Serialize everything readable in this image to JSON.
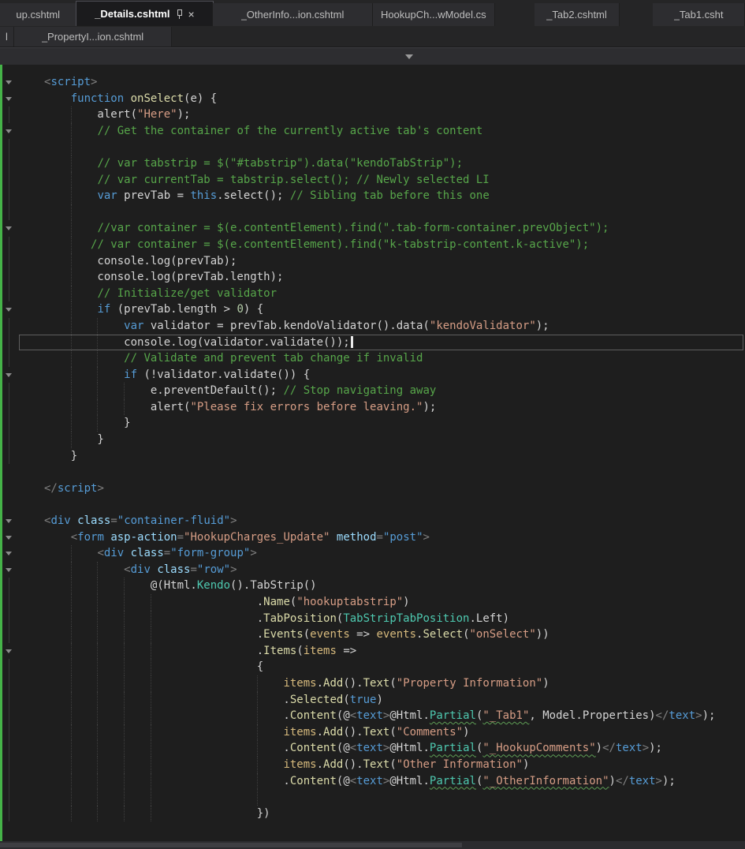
{
  "tabs": {
    "row1": [
      {
        "label": "up.cshtml"
      },
      {
        "label": "_Details.cshtml"
      },
      {
        "label": "_OtherInfo...ion.cshtml"
      },
      {
        "label": "HookupCh...wModel.cs"
      },
      {
        "label": "_Tab2.cshtml"
      },
      {
        "label": "_Tab1.csht"
      }
    ],
    "row2": [
      {
        "label": "l"
      },
      {
        "label": "_PropertyI...ion.cshtml"
      }
    ]
  },
  "icons": {
    "close": "×"
  },
  "palette": {
    "background": "#1e1e1e",
    "tab_strip": "#252526",
    "tab": "#2d2d30",
    "active_tab_text": "#ffffff",
    "keyword": "#569cd6",
    "string": "#d69d85",
    "comment": "#57a64a",
    "method": "#dcdcaa",
    "type": "#4ec9b0",
    "parameter": "#d7ba7d",
    "number": "#b5cea8",
    "attribute": "#9cdcfe",
    "plain": "#d4d4d4",
    "change_bar": "#45b348"
  },
  "editor": {
    "lines": [
      {
        "f": true,
        "t": [
          [
            "d",
            "<"
          ],
          [
            "t",
            "script"
          ],
          [
            "d",
            ">"
          ]
        ]
      },
      {
        "f": true,
        "t": [
          [
            "p",
            "    "
          ],
          [
            "k",
            "function"
          ],
          [
            "p",
            " "
          ],
          [
            "m",
            "onSelect"
          ],
          [
            "p",
            "(e) {"
          ]
        ]
      },
      {
        "ml": 1,
        "g": [
          4
        ],
        "t": [
          [
            "p",
            "        alert("
          ],
          [
            "s",
            "\"Here\""
          ],
          [
            "p",
            ");"
          ]
        ]
      },
      {
        "f": true,
        "g": [
          4
        ],
        "t": [
          [
            "p",
            "        "
          ],
          [
            "c",
            "// Get the container of the currently active tab's content"
          ]
        ]
      },
      {
        "ml": 1,
        "g": [
          4
        ],
        "t": []
      },
      {
        "ml": 1,
        "g": [
          4
        ],
        "t": [
          [
            "p",
            "        "
          ],
          [
            "c",
            "// var tabstrip = $(\"#tabstrip\").data(\"kendoTabStrip\");"
          ]
        ]
      },
      {
        "ml": 1,
        "g": [
          4
        ],
        "t": [
          [
            "p",
            "        "
          ],
          [
            "c",
            "// var currentTab = tabstrip.select(); // Newly selected LI"
          ]
        ]
      },
      {
        "ml": 1,
        "g": [
          4
        ],
        "t": [
          [
            "p",
            "        "
          ],
          [
            "k",
            "var"
          ],
          [
            "p",
            " prevTab = "
          ],
          [
            "k",
            "this"
          ],
          [
            "p",
            ".select(); "
          ],
          [
            "c",
            "// Sibling tab before this one"
          ]
        ]
      },
      {
        "ml": 1,
        "g": [
          4
        ],
        "t": []
      },
      {
        "f": true,
        "g": [
          4
        ],
        "t": [
          [
            "p",
            "        "
          ],
          [
            "c",
            "//var container = $(e.contentElement).find(\".tab-form-container.prevObject\");"
          ]
        ]
      },
      {
        "ml": 1,
        "g": [
          4
        ],
        "t": [
          [
            "p",
            "       "
          ],
          [
            "c",
            "// var container = $(e.contentElement).find(\"k-tabstrip-content.k-active\");"
          ]
        ]
      },
      {
        "ml": 1,
        "g": [
          4
        ],
        "t": [
          [
            "p",
            "        console.log(prevTab);"
          ]
        ]
      },
      {
        "ml": 1,
        "g": [
          4
        ],
        "t": [
          [
            "p",
            "        console.log(prevTab.length);"
          ]
        ]
      },
      {
        "ml": 1,
        "g": [
          4
        ],
        "t": [
          [
            "p",
            "        "
          ],
          [
            "c",
            "// Initialize/get validator"
          ]
        ]
      },
      {
        "f": true,
        "g": [
          4
        ],
        "t": [
          [
            "p",
            "        "
          ],
          [
            "k",
            "if"
          ],
          [
            "p",
            " (prevTab.length > "
          ],
          [
            "n",
            "0"
          ],
          [
            "p",
            ") {"
          ]
        ]
      },
      {
        "ml": 1,
        "g": [
          4,
          8
        ],
        "t": [
          [
            "p",
            "            "
          ],
          [
            "k",
            "var"
          ],
          [
            "p",
            " validator = prevTab.kendoValidator().data("
          ],
          [
            "s",
            "\"kendoValidator\""
          ],
          [
            "p",
            ");"
          ]
        ]
      },
      {
        "ml": 1,
        "g": [
          4,
          8
        ],
        "cur": true,
        "caret": true,
        "t": [
          [
            "p",
            "            console.log(validator.validate());"
          ]
        ]
      },
      {
        "ml": 1,
        "g": [
          4,
          8
        ],
        "t": [
          [
            "p",
            "            "
          ],
          [
            "c",
            "// Validate and prevent tab change if invalid"
          ]
        ]
      },
      {
        "f": true,
        "g": [
          4,
          8
        ],
        "t": [
          [
            "p",
            "            "
          ],
          [
            "k",
            "if"
          ],
          [
            "p",
            " (!validator.validate()) {"
          ]
        ]
      },
      {
        "ml": 1,
        "g": [
          4,
          8,
          12
        ],
        "t": [
          [
            "p",
            "                e.preventDefault(); "
          ],
          [
            "c",
            "// Stop navigating away"
          ]
        ]
      },
      {
        "ml": 1,
        "g": [
          4,
          8,
          12
        ],
        "t": [
          [
            "p",
            "                alert("
          ],
          [
            "s",
            "\"Please fix errors before leaving.\""
          ],
          [
            "p",
            ");"
          ]
        ]
      },
      {
        "ml": 1,
        "g": [
          4,
          8
        ],
        "t": [
          [
            "p",
            "            }"
          ]
        ]
      },
      {
        "ml": 1,
        "g": [
          4
        ],
        "t": [
          [
            "p",
            "        }"
          ]
        ]
      },
      {
        "ml": 1,
        "t": [
          [
            "p",
            "    }"
          ]
        ]
      },
      {
        "t": []
      },
      {
        "t": [
          [
            "d",
            "</"
          ],
          [
            "t",
            "script"
          ],
          [
            "d",
            ">"
          ]
        ]
      },
      {
        "t": []
      },
      {
        "f": true,
        "t": [
          [
            "d",
            "<"
          ],
          [
            "t",
            "div"
          ],
          [
            "p",
            " "
          ],
          [
            "a",
            "class"
          ],
          [
            "d",
            "="
          ],
          [
            "v",
            "\"container-fluid\""
          ],
          [
            "d",
            ">"
          ]
        ]
      },
      {
        "f": true,
        "t": [
          [
            "p",
            "    "
          ],
          [
            "d",
            "<"
          ],
          [
            "t",
            "form"
          ],
          [
            "p",
            " "
          ],
          [
            "a",
            "asp-action"
          ],
          [
            "d",
            "="
          ],
          [
            "s",
            "\"HookupCharges_Update\""
          ],
          [
            "p",
            " "
          ],
          [
            "a",
            "method"
          ],
          [
            "d",
            "="
          ],
          [
            "v",
            "\"post\""
          ],
          [
            "d",
            ">"
          ]
        ]
      },
      {
        "f": true,
        "g": [
          4
        ],
        "t": [
          [
            "p",
            "        "
          ],
          [
            "d",
            "<"
          ],
          [
            "t",
            "div"
          ],
          [
            "p",
            " "
          ],
          [
            "a",
            "class"
          ],
          [
            "d",
            "="
          ],
          [
            "v",
            "\"form-group\""
          ],
          [
            "d",
            ">"
          ]
        ]
      },
      {
        "f": true,
        "g": [
          4,
          8
        ],
        "t": [
          [
            "p",
            "            "
          ],
          [
            "d",
            "<"
          ],
          [
            "t",
            "div"
          ],
          [
            "p",
            " "
          ],
          [
            "a",
            "class"
          ],
          [
            "d",
            "="
          ],
          [
            "v",
            "\"row\""
          ],
          [
            "d",
            ">"
          ]
        ]
      },
      {
        "ml": 1,
        "g": [
          4,
          8,
          12
        ],
        "t": [
          [
            "p",
            "                @(Html."
          ],
          [
            "x",
            "Kendo"
          ],
          [
            "p",
            "().TabStrip()"
          ]
        ]
      },
      {
        "ml": 1,
        "g": [
          4,
          8,
          12,
          16
        ],
        "t": [
          [
            "p",
            "                                ."
          ],
          [
            "m",
            "Name"
          ],
          [
            "p",
            "("
          ],
          [
            "s",
            "\"hookuptabstrip\""
          ],
          [
            "p",
            ")"
          ]
        ]
      },
      {
        "ml": 1,
        "g": [
          4,
          8,
          12,
          16
        ],
        "t": [
          [
            "p",
            "                                ."
          ],
          [
            "m",
            "TabPosition"
          ],
          [
            "p",
            "("
          ],
          [
            "x",
            "TabStripTabPosition"
          ],
          [
            "p",
            ".Left)"
          ]
        ]
      },
      {
        "ml": 1,
        "g": [
          4,
          8,
          12,
          16
        ],
        "t": [
          [
            "p",
            "                                ."
          ],
          [
            "m",
            "Events"
          ],
          [
            "p",
            "("
          ],
          [
            "g",
            "events"
          ],
          [
            "p",
            " => "
          ],
          [
            "g",
            "events"
          ],
          [
            "p",
            "."
          ],
          [
            "m",
            "Select"
          ],
          [
            "p",
            "("
          ],
          [
            "s",
            "\"onSelect\""
          ],
          [
            "p",
            "))"
          ]
        ]
      },
      {
        "f": true,
        "g": [
          4,
          8,
          12,
          16
        ],
        "t": [
          [
            "p",
            "                                ."
          ],
          [
            "m",
            "Items"
          ],
          [
            "p",
            "("
          ],
          [
            "g",
            "items"
          ],
          [
            "p",
            " =>"
          ]
        ]
      },
      {
        "ml": 1,
        "g": [
          4,
          8,
          12,
          16
        ],
        "t": [
          [
            "p",
            "                                {"
          ]
        ]
      },
      {
        "ml": 1,
        "g": [
          4,
          8,
          12,
          16,
          32
        ],
        "t": [
          [
            "p",
            "                                    "
          ],
          [
            "g",
            "items"
          ],
          [
            "p",
            "."
          ],
          [
            "m",
            "Add"
          ],
          [
            "p",
            "()."
          ],
          [
            "m",
            "Text"
          ],
          [
            "p",
            "("
          ],
          [
            "s",
            "\"Property Information\""
          ],
          [
            "p",
            ")"
          ]
        ]
      },
      {
        "ml": 1,
        "g": [
          4,
          8,
          12,
          16,
          32
        ],
        "t": [
          [
            "p",
            "                                    ."
          ],
          [
            "m",
            "Selected"
          ],
          [
            "p",
            "("
          ],
          [
            "k",
            "true"
          ],
          [
            "p",
            ")"
          ]
        ]
      },
      {
        "ml": 1,
        "g": [
          4,
          8,
          12,
          16,
          32
        ],
        "t": [
          [
            "p",
            "                                    ."
          ],
          [
            "m",
            "Content"
          ],
          [
            "p",
            "(@"
          ],
          [
            "d",
            "<"
          ],
          [
            "t",
            "text"
          ],
          [
            "d",
            ">"
          ],
          [
            "p",
            "@Html."
          ],
          [
            "x sq",
            "Partial"
          ],
          [
            "p",
            "("
          ],
          [
            "s sq",
            "\"_Tab1\""
          ],
          [
            "p",
            ", Model.Properties)"
          ],
          [
            "d",
            "</"
          ],
          [
            "t",
            "text"
          ],
          [
            "d",
            ">"
          ],
          [
            "p",
            ");"
          ]
        ]
      },
      {
        "ml": 1,
        "g": [
          4,
          8,
          12,
          16,
          32
        ],
        "t": [
          [
            "p",
            "                                    "
          ],
          [
            "g",
            "items"
          ],
          [
            "p",
            "."
          ],
          [
            "m",
            "Add"
          ],
          [
            "p",
            "()."
          ],
          [
            "m",
            "Text"
          ],
          [
            "p",
            "("
          ],
          [
            "s",
            "\"Comments\""
          ],
          [
            "p",
            ")"
          ]
        ]
      },
      {
        "ml": 1,
        "g": [
          4,
          8,
          12,
          16,
          32
        ],
        "t": [
          [
            "p",
            "                                    ."
          ],
          [
            "m",
            "Content"
          ],
          [
            "p",
            "(@"
          ],
          [
            "d",
            "<"
          ],
          [
            "t",
            "text"
          ],
          [
            "d",
            ">"
          ],
          [
            "p",
            "@Html."
          ],
          [
            "x sq",
            "Partial"
          ],
          [
            "p",
            "("
          ],
          [
            "s sq",
            "\"_HookupComments\""
          ],
          [
            "p",
            ")"
          ],
          [
            "d",
            "</"
          ],
          [
            "t",
            "text"
          ],
          [
            "d",
            ">"
          ],
          [
            "p",
            ");"
          ]
        ]
      },
      {
        "ml": 1,
        "g": [
          4,
          8,
          12,
          16,
          32
        ],
        "t": [
          [
            "p",
            "                                    "
          ],
          [
            "g",
            "items"
          ],
          [
            "p",
            "."
          ],
          [
            "m",
            "Add"
          ],
          [
            "p",
            "()."
          ],
          [
            "m",
            "Text"
          ],
          [
            "p",
            "("
          ],
          [
            "s",
            "\"Other Information\""
          ],
          [
            "p",
            ")"
          ]
        ]
      },
      {
        "ml": 1,
        "g": [
          4,
          8,
          12,
          16,
          32
        ],
        "t": [
          [
            "p",
            "                                    ."
          ],
          [
            "m",
            "Content"
          ],
          [
            "p",
            "(@"
          ],
          [
            "d",
            "<"
          ],
          [
            "t",
            "text"
          ],
          [
            "d",
            ">"
          ],
          [
            "p",
            "@Html."
          ],
          [
            "x sq",
            "Partial"
          ],
          [
            "p",
            "("
          ],
          [
            "s sq",
            "\"_OtherInformation\""
          ],
          [
            "p",
            ")"
          ],
          [
            "d",
            "</"
          ],
          [
            "t",
            "text"
          ],
          [
            "d",
            ">"
          ],
          [
            "p",
            ");"
          ]
        ]
      },
      {
        "ml": 1,
        "g": [
          4,
          8,
          12,
          16,
          32
        ],
        "t": []
      },
      {
        "ml": 1,
        "g": [
          4,
          8,
          12,
          16
        ],
        "t": [
          [
            "p",
            "                                })"
          ]
        ]
      },
      {
        "t": []
      }
    ]
  }
}
